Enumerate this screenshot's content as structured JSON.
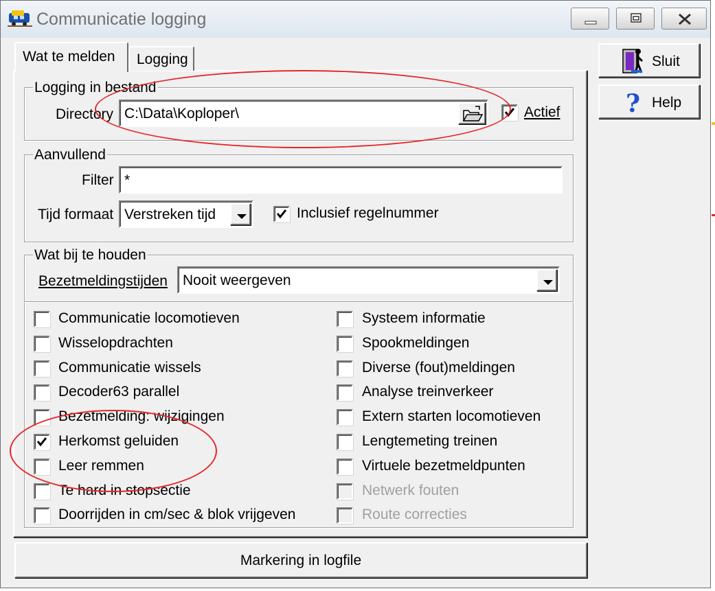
{
  "window": {
    "title": "Communicatie logging"
  },
  "tabs": [
    {
      "label": "Wat te melden",
      "active": true
    },
    {
      "label": "Logging",
      "active": false
    }
  ],
  "side_buttons": {
    "close_label": "Sluit",
    "help_label": "Help"
  },
  "logging_group": {
    "legend": "Logging in bestand",
    "directory_label": "Directory",
    "directory_value": "C:\\Data\\Koploper\\",
    "actief_label": "Actief",
    "actief_checked": true
  },
  "aanvullend_group": {
    "legend": "Aanvullend",
    "filter_label": "Filter",
    "filter_value": "*",
    "tijd_label": "Tijd formaat",
    "tijd_value": "Verstreken tijd",
    "regelnummer_label": "Inclusief regelnummer",
    "regelnummer_checked": true
  },
  "bijhouden_group": {
    "legend": "Wat bij te houden",
    "bezet_label": "Bezetmeldingstijden",
    "bezet_value": "Nooit weergeven",
    "left_options": [
      {
        "label": "Communicatie locomotieven",
        "checked": false,
        "enabled": true
      },
      {
        "label": "Wisselopdrachten",
        "checked": false,
        "enabled": true
      },
      {
        "label": "Communicatie wissels",
        "checked": false,
        "enabled": true
      },
      {
        "label": "Decoder63 parallel",
        "checked": false,
        "enabled": true
      },
      {
        "label": "Bezetmelding: wijzigingen",
        "checked": false,
        "enabled": true
      },
      {
        "label": "Herkomst geluiden",
        "checked": true,
        "enabled": true
      },
      {
        "label": "Leer remmen",
        "checked": false,
        "enabled": true
      },
      {
        "label": "Te hard in stopsectie",
        "checked": false,
        "enabled": true
      },
      {
        "label": "Doorrijden in cm/sec & blok vrijgeven",
        "checked": false,
        "enabled": true
      }
    ],
    "right_options": [
      {
        "label": "Systeem informatie",
        "checked": false,
        "enabled": true
      },
      {
        "label": "Spookmeldingen",
        "checked": false,
        "enabled": true
      },
      {
        "label": "Diverse (fout)meldingen",
        "checked": false,
        "enabled": true
      },
      {
        "label": "Analyse treinverkeer",
        "checked": false,
        "enabled": true
      },
      {
        "label": "Extern starten locomotieven",
        "checked": false,
        "enabled": true
      },
      {
        "label": "Lengtemeting treinen",
        "checked": false,
        "enabled": true
      },
      {
        "label": "Virtuele bezetmeldpunten",
        "checked": false,
        "enabled": true
      },
      {
        "label": "Netwerk fouten",
        "checked": false,
        "enabled": false
      },
      {
        "label": "Route correcties",
        "checked": false,
        "enabled": false
      }
    ]
  },
  "marker_button": {
    "label": "Markering in logfile"
  },
  "colors": {
    "annotation": "#e5262a",
    "face": "#f0f0f0",
    "disabled_text": "#a0a0a0"
  }
}
